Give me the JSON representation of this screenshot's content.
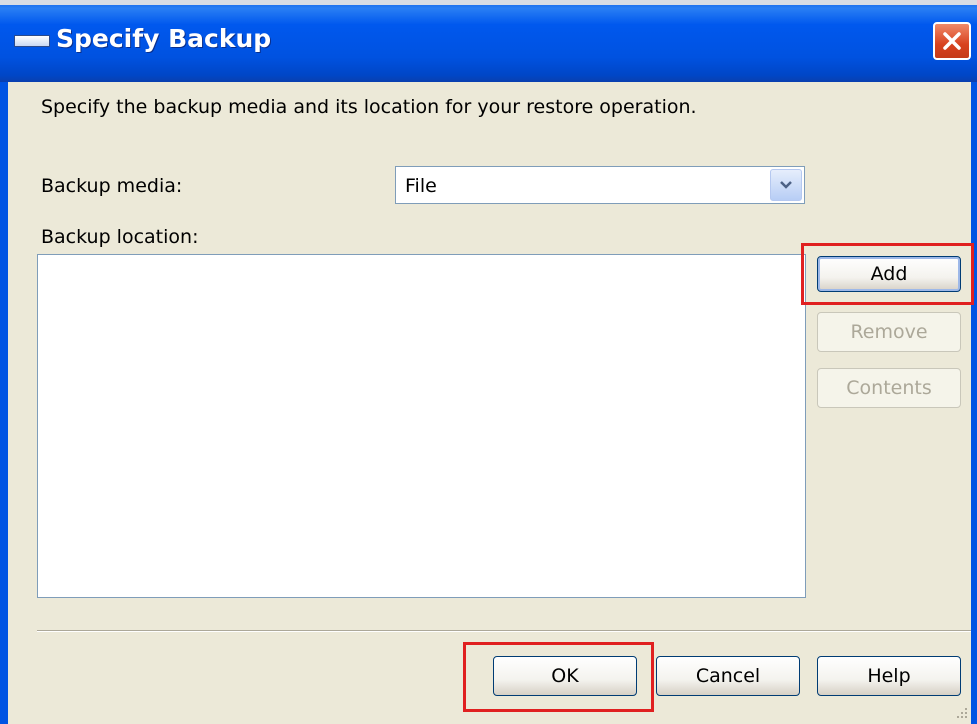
{
  "window": {
    "title": "Specify Backup",
    "close_icon": "close-icon"
  },
  "dialog": {
    "instructions": "Specify the backup media and its location for your restore operation.",
    "backup_media_label": "Backup media:",
    "backup_media_value": "File",
    "backup_location_label": "Backup location:",
    "backup_locations": []
  },
  "side_buttons": {
    "add": "Add",
    "remove": "Remove",
    "contents": "Contents"
  },
  "footer_buttons": {
    "ok": "OK",
    "cancel": "Cancel",
    "help": "Help"
  },
  "colors": {
    "titlebar": "#0054e3",
    "highlight": "#e02020",
    "face": "#ece9d8"
  }
}
